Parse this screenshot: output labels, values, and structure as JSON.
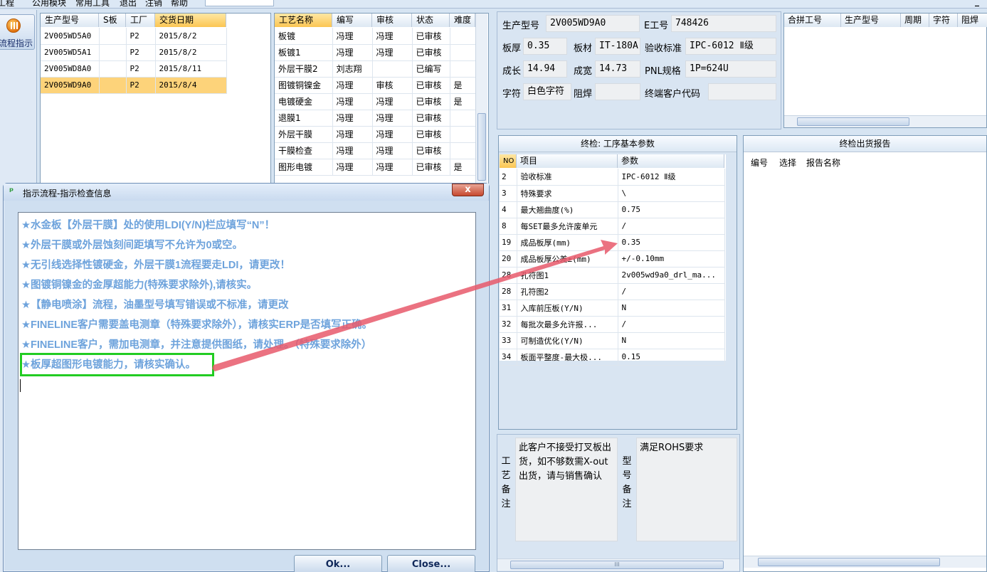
{
  "menu": [
    "工程",
    "公用模块",
    "常用工具",
    "退出",
    "注销",
    "帮助"
  ],
  "window_controls": "_",
  "flow_button": {
    "label": "流程指示",
    "icon": "pause-icon"
  },
  "orders": {
    "headers": [
      "生产型号",
      "S板",
      "工厂",
      "交货日期"
    ],
    "rows": [
      [
        "2V005WD5A0",
        "",
        "P2",
        "2015/8/2"
      ],
      [
        "2V005WD5A1",
        "",
        "P2",
        "2015/8/2"
      ],
      [
        "2V005WD8A0",
        "",
        "P2",
        "2015/8/11"
      ],
      [
        "2V005WD9A0",
        "",
        "P2",
        "2015/8/4"
      ]
    ],
    "selected_index": 3
  },
  "processes": {
    "headers": [
      "工艺名称",
      "编写",
      "审核",
      "状态",
      "难度"
    ],
    "rows": [
      [
        "板镀",
        "冯理",
        "冯理",
        "已审核",
        ""
      ],
      [
        "板镀1",
        "冯理",
        "冯理",
        "已审核",
        ""
      ],
      [
        "外层干膜2",
        "刘志翔",
        "",
        "已编写",
        ""
      ],
      [
        "图镀铜镍金",
        "冯理",
        "审核",
        "已审核",
        "是"
      ],
      [
        "电镀硬金",
        "冯理",
        "冯理",
        "已审核",
        "是"
      ],
      [
        "退膜1",
        "冯理",
        "冯理",
        "已审核",
        ""
      ],
      [
        "外层干膜",
        "冯理",
        "冯理",
        "已审核",
        ""
      ],
      [
        "干膜检查",
        "冯理",
        "冯理",
        "已审核",
        ""
      ],
      [
        "图形电镀",
        "冯理",
        "冯理",
        "已审核",
        "是"
      ]
    ]
  },
  "info": {
    "product_model_label": "生产型号",
    "product_model": "2V005WD9A0",
    "e_no_label": "E工号",
    "e_no": "748426",
    "thickness_label": "板厚",
    "thickness": "0.35",
    "material_label": "板材",
    "material": "IT-180A",
    "standard_label": "验收标准",
    "standard": "IPC-6012 Ⅱ级",
    "length_label": "成长",
    "length": "14.94",
    "width_label": "成宽",
    "width": "14.73",
    "pnl_label": "PNL规格",
    "pnl": "1P=624U",
    "char_label": "字符",
    "char": "白色字符",
    "solder_label": "阻焊",
    "solder": "",
    "customer_label": "终端客户代码",
    "customer": ""
  },
  "merge": {
    "headers": [
      "合拼工号",
      "生产型号",
      "周期",
      "字符",
      "阻焊"
    ]
  },
  "final_params": {
    "title": "终检: 工序基本参数",
    "headers": [
      "NO",
      "项目",
      "参数"
    ],
    "rows": [
      [
        "2",
        "验收标准",
        "IPC-6012 Ⅱ级"
      ],
      [
        "3",
        "特殊要求",
        "\\"
      ],
      [
        "4",
        "最大翘曲度(%)",
        "0.75"
      ],
      [
        "8",
        "每SET最多允许废单元",
        "/"
      ],
      [
        "19",
        "成品板厚(mm)",
        "0.35"
      ],
      [
        "20",
        "成品板厚公差±(mm)",
        "+/-0.10mm"
      ],
      [
        "28",
        "孔符图1",
        "2v005wd9a0_drl_ma..."
      ],
      [
        "28",
        "孔符图2",
        "/"
      ],
      [
        "31",
        "入库前压板(Y/N)",
        "N"
      ],
      [
        "32",
        "每批次最多允许报...",
        "/"
      ],
      [
        "33",
        "可制造优化(Y/N)",
        "N"
      ],
      [
        "34",
        "板面平整度-最大极...",
        "0.15"
      ]
    ]
  },
  "report": {
    "title": "终检出货报告",
    "headers": [
      "编号",
      "选择",
      "报告名称"
    ]
  },
  "remarks": {
    "process_label": "工艺备注",
    "process_text": "此客户不接受打叉板出货，如不够数需X-out出货，请与销售确认",
    "model_label": "型号备注",
    "model_text": "满足ROHS要求"
  },
  "scrollbar_grip": "III",
  "dialog": {
    "title": "指示流程-指示检查信息",
    "close_glyph": "x",
    "messages": [
      "★水金板【外层干膜】处的使用LDI(Y/N)栏应填写“N”！",
      "★外层干膜或外层蚀刻间距填写不允许为0或空。",
      "★无引线选择性镀硬金，外层干膜1流程要走LDI，请更改！",
      "★图镀铜镍金的金厚超能力(特殊要求除外),请核实。",
      "★【静电喷涂】流程，油墨型号填写错误或不标准，请更改",
      "★FINELINE客户需要盖电测章（特殊要求除外），请核实ERP是否填写正确。",
      "★FINELINE客户，需加电测章，并注意提供图纸，请处理。（特殊要求除外）",
      "★板厚超图形电镀能力，请核实确认。"
    ],
    "highlighted_index": 7,
    "ok_label": "Ok...",
    "close_label": "Close..."
  },
  "colors": {
    "highlight_box": "#22cc22",
    "arrow": "#e8596b",
    "message_text": "#6ea3dc",
    "selected_row": "#fdd37a"
  }
}
